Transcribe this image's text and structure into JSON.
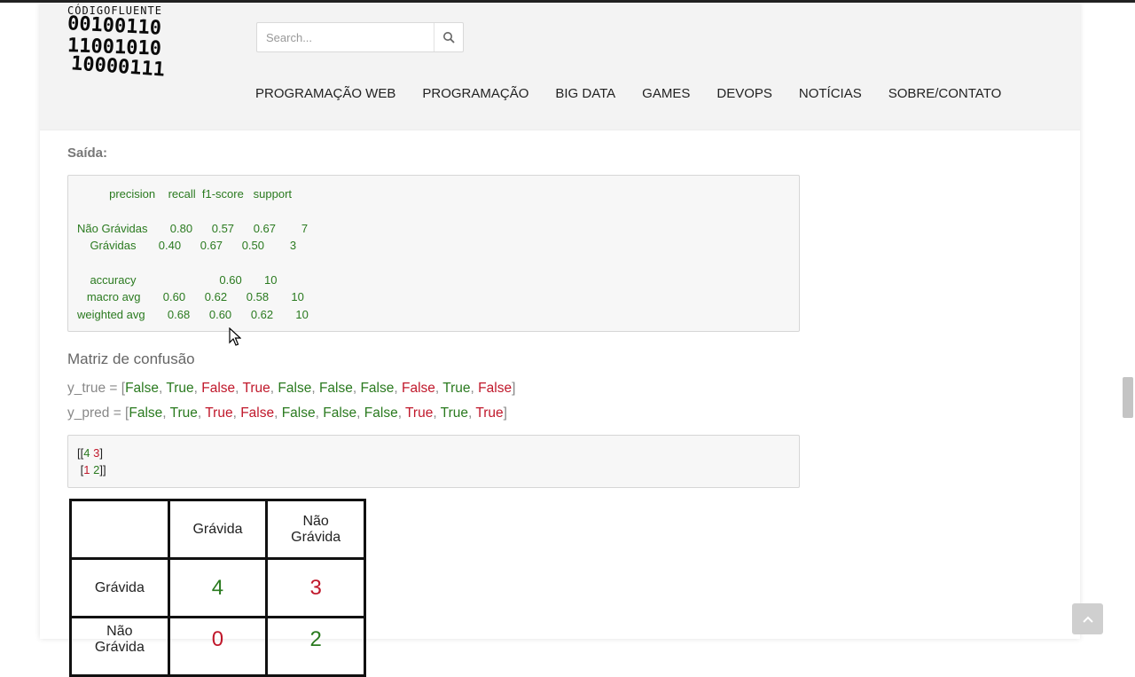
{
  "site": {
    "logo_title": "CÓDIGOFLUENTE",
    "logo_lines": [
      "00100110",
      "11001010",
      "10000111"
    ]
  },
  "search": {
    "placeholder": "Search..."
  },
  "nav": [
    {
      "label": "PROGRAMAÇÃO WEB"
    },
    {
      "label": "PROGRAMAÇÃO"
    },
    {
      "label": "BIG DATA"
    },
    {
      "label": "GAMES"
    },
    {
      "label": "DEVOPS"
    },
    {
      "label": "NOTÍCIAS"
    },
    {
      "label": "SOBRE/CONTATO"
    }
  ],
  "content": {
    "output_label": "Saída:",
    "report": {
      "header": "          precision    recall  f1-score   support",
      "rows": [
        "Não Grávidas       0.80      0.57      0.67        7",
        "    Grávidas       0.40      0.67      0.50        3",
        "    accuracy                          0.60       10",
        "   macro avg       0.60      0.62      0.58       10",
        "weighted avg       0.68      0.60      0.62       10"
      ]
    },
    "matrix_title": "Matriz de confusão",
    "y_true_label": "y_true = [",
    "y_true": [
      "False",
      "True",
      "False",
      "True",
      "False",
      "False",
      "False",
      "False",
      "True",
      "False"
    ],
    "y_pred_label": "y_pred = [",
    "y_pred": [
      "False",
      "True",
      "True",
      "False",
      "False",
      "False",
      "False",
      "True",
      "True",
      "True"
    ],
    "matrix_output": {
      "row1_open": "[[",
      "row1_a": "4",
      "row1_b": "3",
      "row1_close": "]",
      "row2_open": " [",
      "row2_a": "1",
      "row2_b": "2",
      "row2_close": "]]"
    },
    "confusion_table": {
      "col_headers": [
        "Grávida",
        "Não\nGrávida"
      ],
      "row_headers": [
        "Grávida",
        "Não\nGrávida"
      ],
      "values": [
        [
          "4",
          "3"
        ],
        [
          "0",
          "2"
        ]
      ]
    }
  },
  "colors": {
    "green": "#2a7a1f",
    "red": "#c0182b"
  }
}
